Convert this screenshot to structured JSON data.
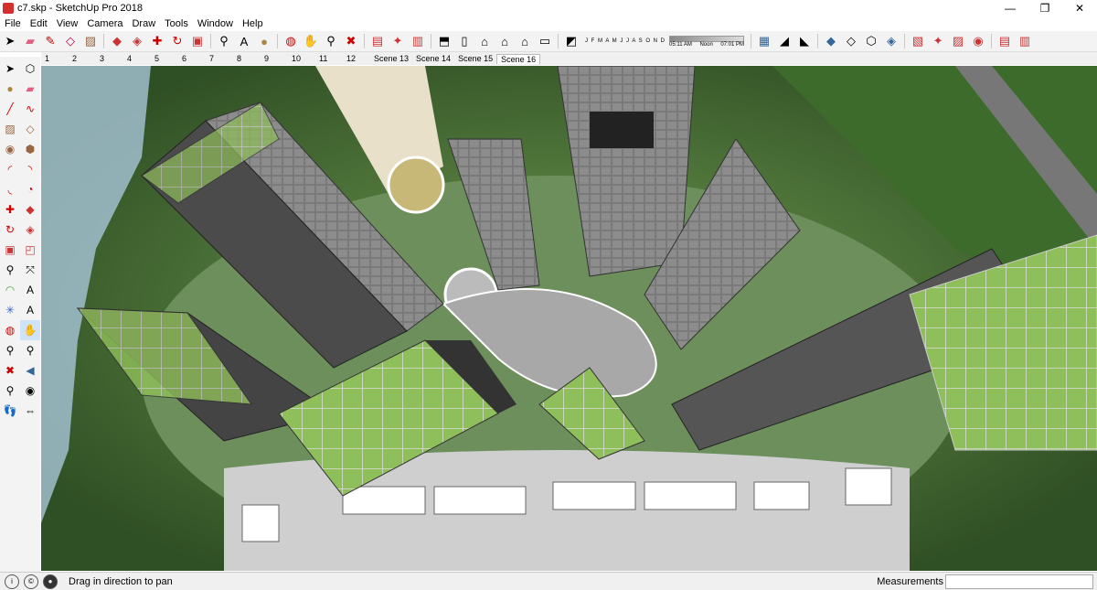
{
  "window": {
    "title": "c7.skp - SketchUp Pro 2018",
    "minimize": "—",
    "maximize": "❐",
    "close": "✕"
  },
  "menu": [
    "File",
    "Edit",
    "View",
    "Camera",
    "Draw",
    "Tools",
    "Window",
    "Help"
  ],
  "toolbar": {
    "icons": [
      "select-arrow",
      "eraser",
      "pencil-line",
      "shape-rectangle",
      "paint-bucket",
      "push-pull",
      "follow-me",
      "move",
      "rotate",
      "scale",
      "tape-measure",
      "text",
      "paint",
      "orbit",
      "pan",
      "zoom",
      "zoom-extents",
      "3d-warehouse",
      "extension-warehouse",
      "components",
      "styles",
      "section-plane",
      "iso-view",
      "top-view",
      "front-view",
      "right-view",
      "back-view",
      "left-view"
    ],
    "shadow_months": "J F M A M J J A S O N D",
    "shadow_time_start": "05:11 AM",
    "shadow_time_noon": "Noon",
    "shadow_time_end": "07:01 PM"
  },
  "scenes": [
    "1",
    "2",
    "3",
    "4",
    "5",
    "6",
    "7",
    "8",
    "9",
    "10",
    "11",
    "12",
    "Scene 13",
    "Scene 14",
    "Scene 15",
    "Scene 16"
  ],
  "active_scene": "Scene 16",
  "status": {
    "hint": "Drag in direction to pan",
    "measurements_label": "Measurements",
    "measurements_value": ""
  }
}
